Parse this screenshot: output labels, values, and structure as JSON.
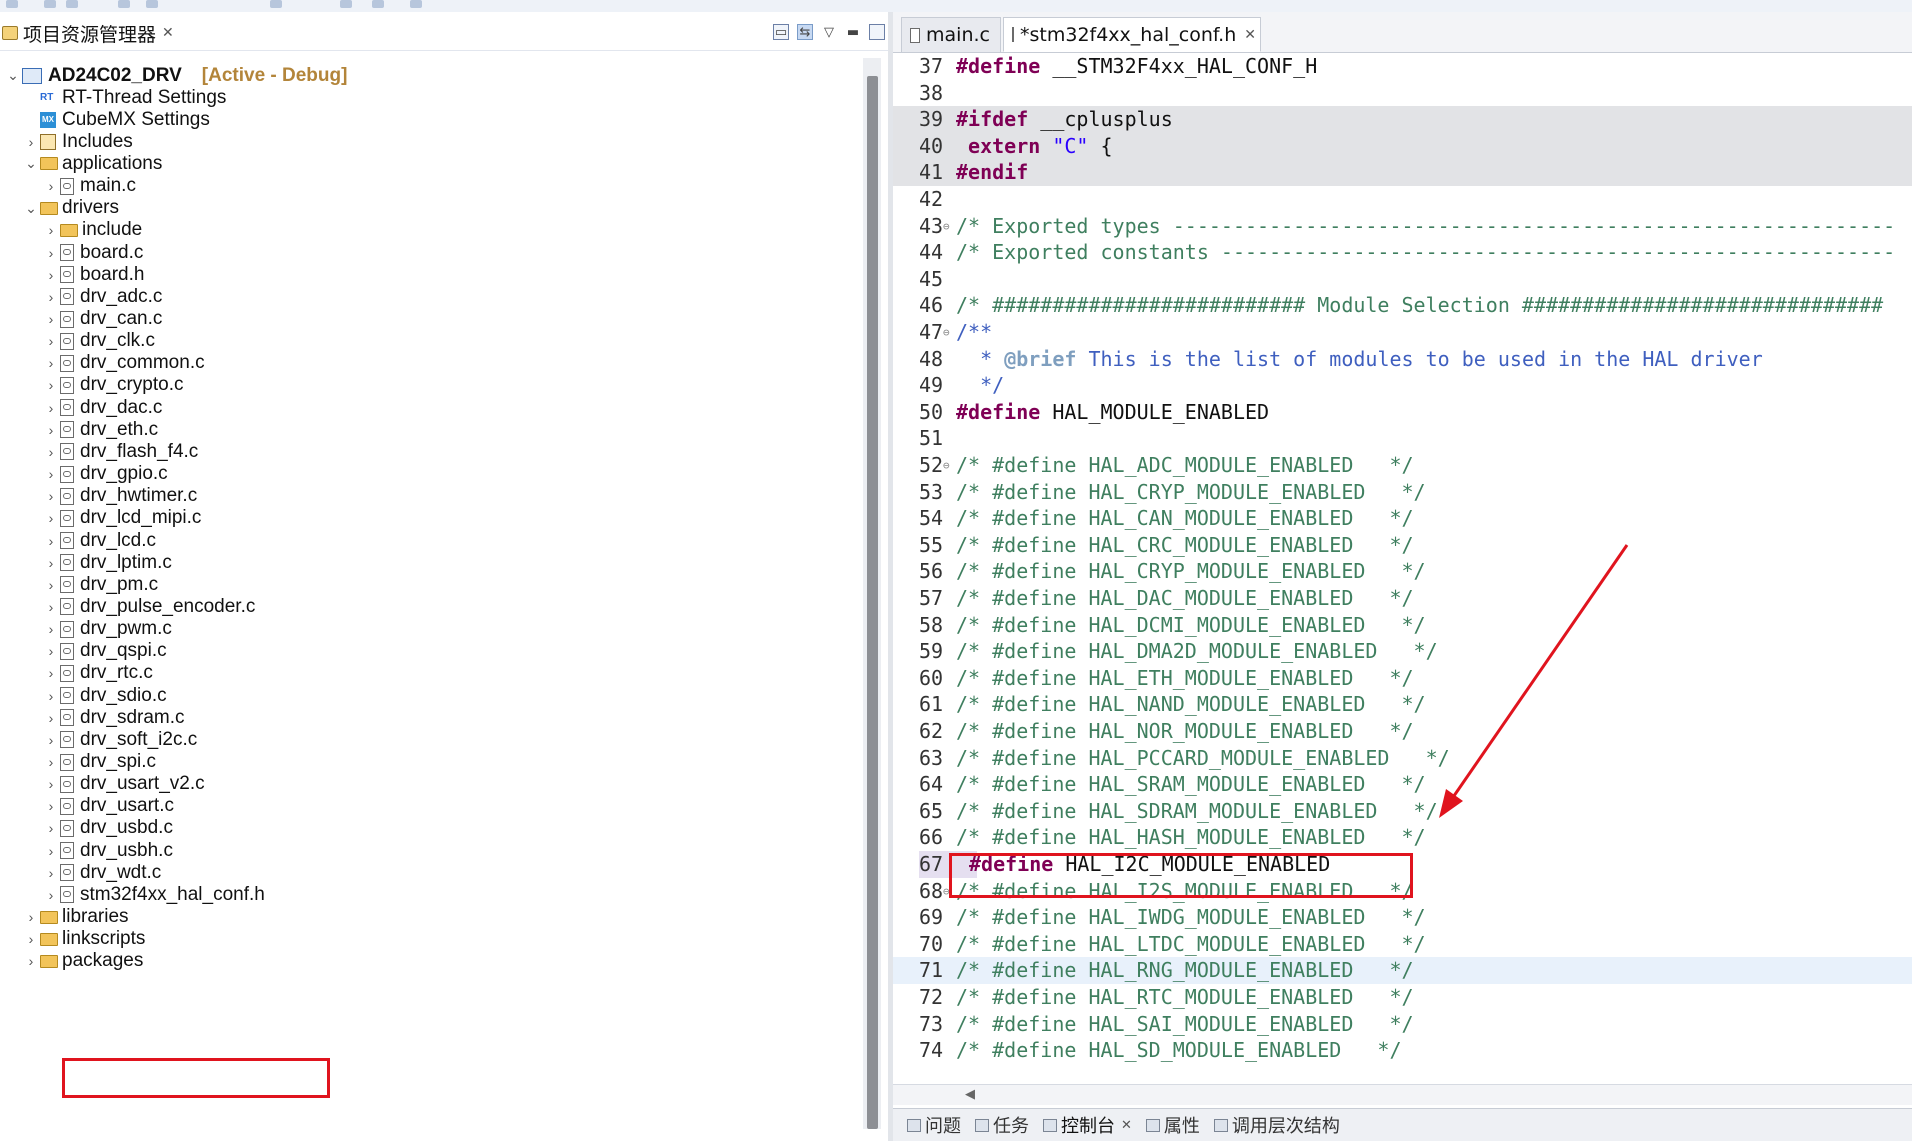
{
  "explorer": {
    "title": "项目资源管理器",
    "project": {
      "name": "AD24C02_DRV",
      "status": "[Active - Debug]"
    },
    "items": [
      {
        "label": "RT-Thread Settings",
        "kind": "rt"
      },
      {
        "label": "CubeMX Settings",
        "kind": "mx"
      },
      {
        "label": "Includes",
        "kind": "inc"
      },
      {
        "label": "applications",
        "kind": "folder"
      },
      {
        "label": "main.c",
        "kind": "file"
      },
      {
        "label": "drivers",
        "kind": "folder"
      },
      {
        "label": "include",
        "kind": "folder"
      },
      {
        "label": "board.c",
        "kind": "file"
      },
      {
        "label": "board.h",
        "kind": "file"
      },
      {
        "label": "drv_adc.c",
        "kind": "file"
      },
      {
        "label": "drv_can.c",
        "kind": "file"
      },
      {
        "label": "drv_clk.c",
        "kind": "file"
      },
      {
        "label": "drv_common.c",
        "kind": "file"
      },
      {
        "label": "drv_crypto.c",
        "kind": "file"
      },
      {
        "label": "drv_dac.c",
        "kind": "file"
      },
      {
        "label": "drv_eth.c",
        "kind": "file"
      },
      {
        "label": "drv_flash_f4.c",
        "kind": "file"
      },
      {
        "label": "drv_gpio.c",
        "kind": "file"
      },
      {
        "label": "drv_hwtimer.c",
        "kind": "file"
      },
      {
        "label": "drv_lcd_mipi.c",
        "kind": "file"
      },
      {
        "label": "drv_lcd.c",
        "kind": "file"
      },
      {
        "label": "drv_lptim.c",
        "kind": "file"
      },
      {
        "label": "drv_pm.c",
        "kind": "file"
      },
      {
        "label": "drv_pulse_encoder.c",
        "kind": "file"
      },
      {
        "label": "drv_pwm.c",
        "kind": "file"
      },
      {
        "label": "drv_qspi.c",
        "kind": "file"
      },
      {
        "label": "drv_rtc.c",
        "kind": "file"
      },
      {
        "label": "drv_sdio.c",
        "kind": "file"
      },
      {
        "label": "drv_sdram.c",
        "kind": "file"
      },
      {
        "label": "drv_soft_i2c.c",
        "kind": "file"
      },
      {
        "label": "drv_spi.c",
        "kind": "file"
      },
      {
        "label": "drv_usart_v2.c",
        "kind": "file"
      },
      {
        "label": "drv_usart.c",
        "kind": "file"
      },
      {
        "label": "drv_usbd.c",
        "kind": "file"
      },
      {
        "label": "drv_usbh.c",
        "kind": "file"
      },
      {
        "label": "drv_wdt.c",
        "kind": "file"
      },
      {
        "label": "stm32f4xx_hal_conf.h",
        "kind": "file"
      },
      {
        "label": "libraries",
        "kind": "folder"
      },
      {
        "label": "linkscripts",
        "kind": "folder"
      },
      {
        "label": "packages",
        "kind": "folder"
      }
    ]
  },
  "editor": {
    "tabs": [
      {
        "label": "main.c"
      },
      {
        "label": "*stm32f4xx_hal_conf.h"
      }
    ],
    "lines": [
      {
        "n": "37",
        "text": "#define __STM32F4xx_HAL_CONF_H"
      },
      {
        "n": "38",
        "text": ""
      },
      {
        "n": "39",
        "text": "#ifdef __cplusplus"
      },
      {
        "n": "40",
        "text": " extern \"C\" {"
      },
      {
        "n": "41",
        "text": "#endif"
      },
      {
        "n": "42",
        "text": ""
      },
      {
        "n": "43",
        "text": "/* Exported types ------------------------------------------------------------"
      },
      {
        "n": "44",
        "text": "/* Exported constants --------------------------------------------------------"
      },
      {
        "n": "45",
        "text": ""
      },
      {
        "n": "46",
        "text": "/* ########################## Module Selection ##############################"
      },
      {
        "n": "47",
        "text": "/**"
      },
      {
        "n": "48",
        "text": "  * @brief This is the list of modules to be used in the HAL driver"
      },
      {
        "n": "49",
        "text": "  */"
      },
      {
        "n": "50",
        "text": "#define HAL_MODULE_ENABLED"
      },
      {
        "n": "51",
        "text": ""
      },
      {
        "n": "52",
        "text": "/* #define HAL_ADC_MODULE_ENABLED   */"
      },
      {
        "n": "53",
        "text": "/* #define HAL_CRYP_MODULE_ENABLED   */"
      },
      {
        "n": "54",
        "text": "/* #define HAL_CAN_MODULE_ENABLED   */"
      },
      {
        "n": "55",
        "text": "/* #define HAL_CRC_MODULE_ENABLED   */"
      },
      {
        "n": "56",
        "text": "/* #define HAL_CRYP_MODULE_ENABLED   */"
      },
      {
        "n": "57",
        "text": "/* #define HAL_DAC_MODULE_ENABLED   */"
      },
      {
        "n": "58",
        "text": "/* #define HAL_DCMI_MODULE_ENABLED   */"
      },
      {
        "n": "59",
        "text": "/* #define HAL_DMA2D_MODULE_ENABLED   */"
      },
      {
        "n": "60",
        "text": "/* #define HAL_ETH_MODULE_ENABLED   */"
      },
      {
        "n": "61",
        "text": "/* #define HAL_NAND_MODULE_ENABLED   */"
      },
      {
        "n": "62",
        "text": "/* #define HAL_NOR_MODULE_ENABLED   */"
      },
      {
        "n": "63",
        "text": "/* #define HAL_PCCARD_MODULE_ENABLED   */"
      },
      {
        "n": "64",
        "text": "/* #define HAL_SRAM_MODULE_ENABLED   */"
      },
      {
        "n": "65",
        "text": "/* #define HAL_SDRAM_MODULE_ENABLED   */"
      },
      {
        "n": "66",
        "text": "/* #define HAL_HASH_MODULE_ENABLED   */"
      },
      {
        "n": "67",
        "text": "#define HAL_I2C_MODULE_ENABLED"
      },
      {
        "n": "68",
        "text": "/* #define HAL_I2S_MODULE_ENABLED   */"
      },
      {
        "n": "69",
        "text": "/* #define HAL_IWDG_MODULE_ENABLED   */"
      },
      {
        "n": "70",
        "text": "/* #define HAL_LTDC_MODULE_ENABLED   */"
      },
      {
        "n": "71",
        "text": "/* #define HAL_RNG_MODULE_ENABLED   */"
      },
      {
        "n": "72",
        "text": "/* #define HAL_RTC_MODULE_ENABLED   */"
      },
      {
        "n": "73",
        "text": "/* #define HAL_SAI_MODULE_ENABLED   */"
      },
      {
        "n": "74",
        "text": "/* #define HAL_SD_MODULE_ENABLED   */"
      }
    ]
  },
  "bottom_panel": {
    "tabs": [
      {
        "label": "问题"
      },
      {
        "label": "任务"
      },
      {
        "label": "控制台"
      },
      {
        "label": "属性"
      },
      {
        "label": "调用层次结构"
      }
    ]
  },
  "colors": {
    "highlight_box": "#e0141e",
    "keyword": "#7f0055",
    "comment": "#3f7f5f",
    "javadoc": "#3f5fbf",
    "string": "#2a00ff",
    "active_config": "#b3853a"
  }
}
